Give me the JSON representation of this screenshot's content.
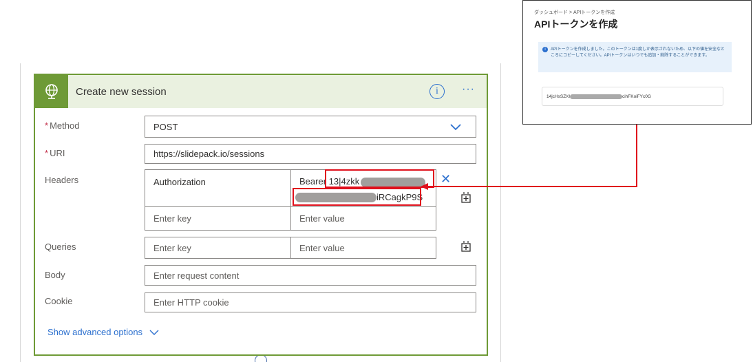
{
  "card": {
    "title": "Create new session",
    "info_icon": "i",
    "more_icon": "···"
  },
  "method": {
    "label": "Method",
    "value": "POST",
    "required": true
  },
  "uri": {
    "label": "URI",
    "value": "https://slidepack.io/sessions",
    "required": true
  },
  "headers": {
    "label": "Headers",
    "row": {
      "key": "Authorization",
      "value_prefix": "Bearer ",
      "value_start": "13|4zkk",
      "value_end": "iRCagkP9S"
    },
    "key_placeholder": "Enter key",
    "value_placeholder": "Enter value"
  },
  "queries": {
    "label": "Queries",
    "key_placeholder": "Enter key",
    "value_placeholder": "Enter value"
  },
  "body": {
    "label": "Body",
    "placeholder": "Enter request content"
  },
  "cookie": {
    "label": "Cookie",
    "placeholder": "Enter HTTP cookie"
  },
  "advanced": {
    "label": "Show advanced options"
  },
  "popup": {
    "breadcrumb": "ダッシュボード  >  APIトークンを作成",
    "title": "APIトークンを作成",
    "notice": "APIトークンを作成しました。このトークンは1度しか表示されないため、以下の値を安全なところにコピーしてください。APIトークンはいつでも追加・削除することができます。",
    "token_start": "14jcHsSZXl",
    "token_end": "cihFKoiFYc0G"
  },
  "colors": {
    "accent": "#6e9a36",
    "link": "#2b6fce",
    "highlight": "#e0101c"
  }
}
